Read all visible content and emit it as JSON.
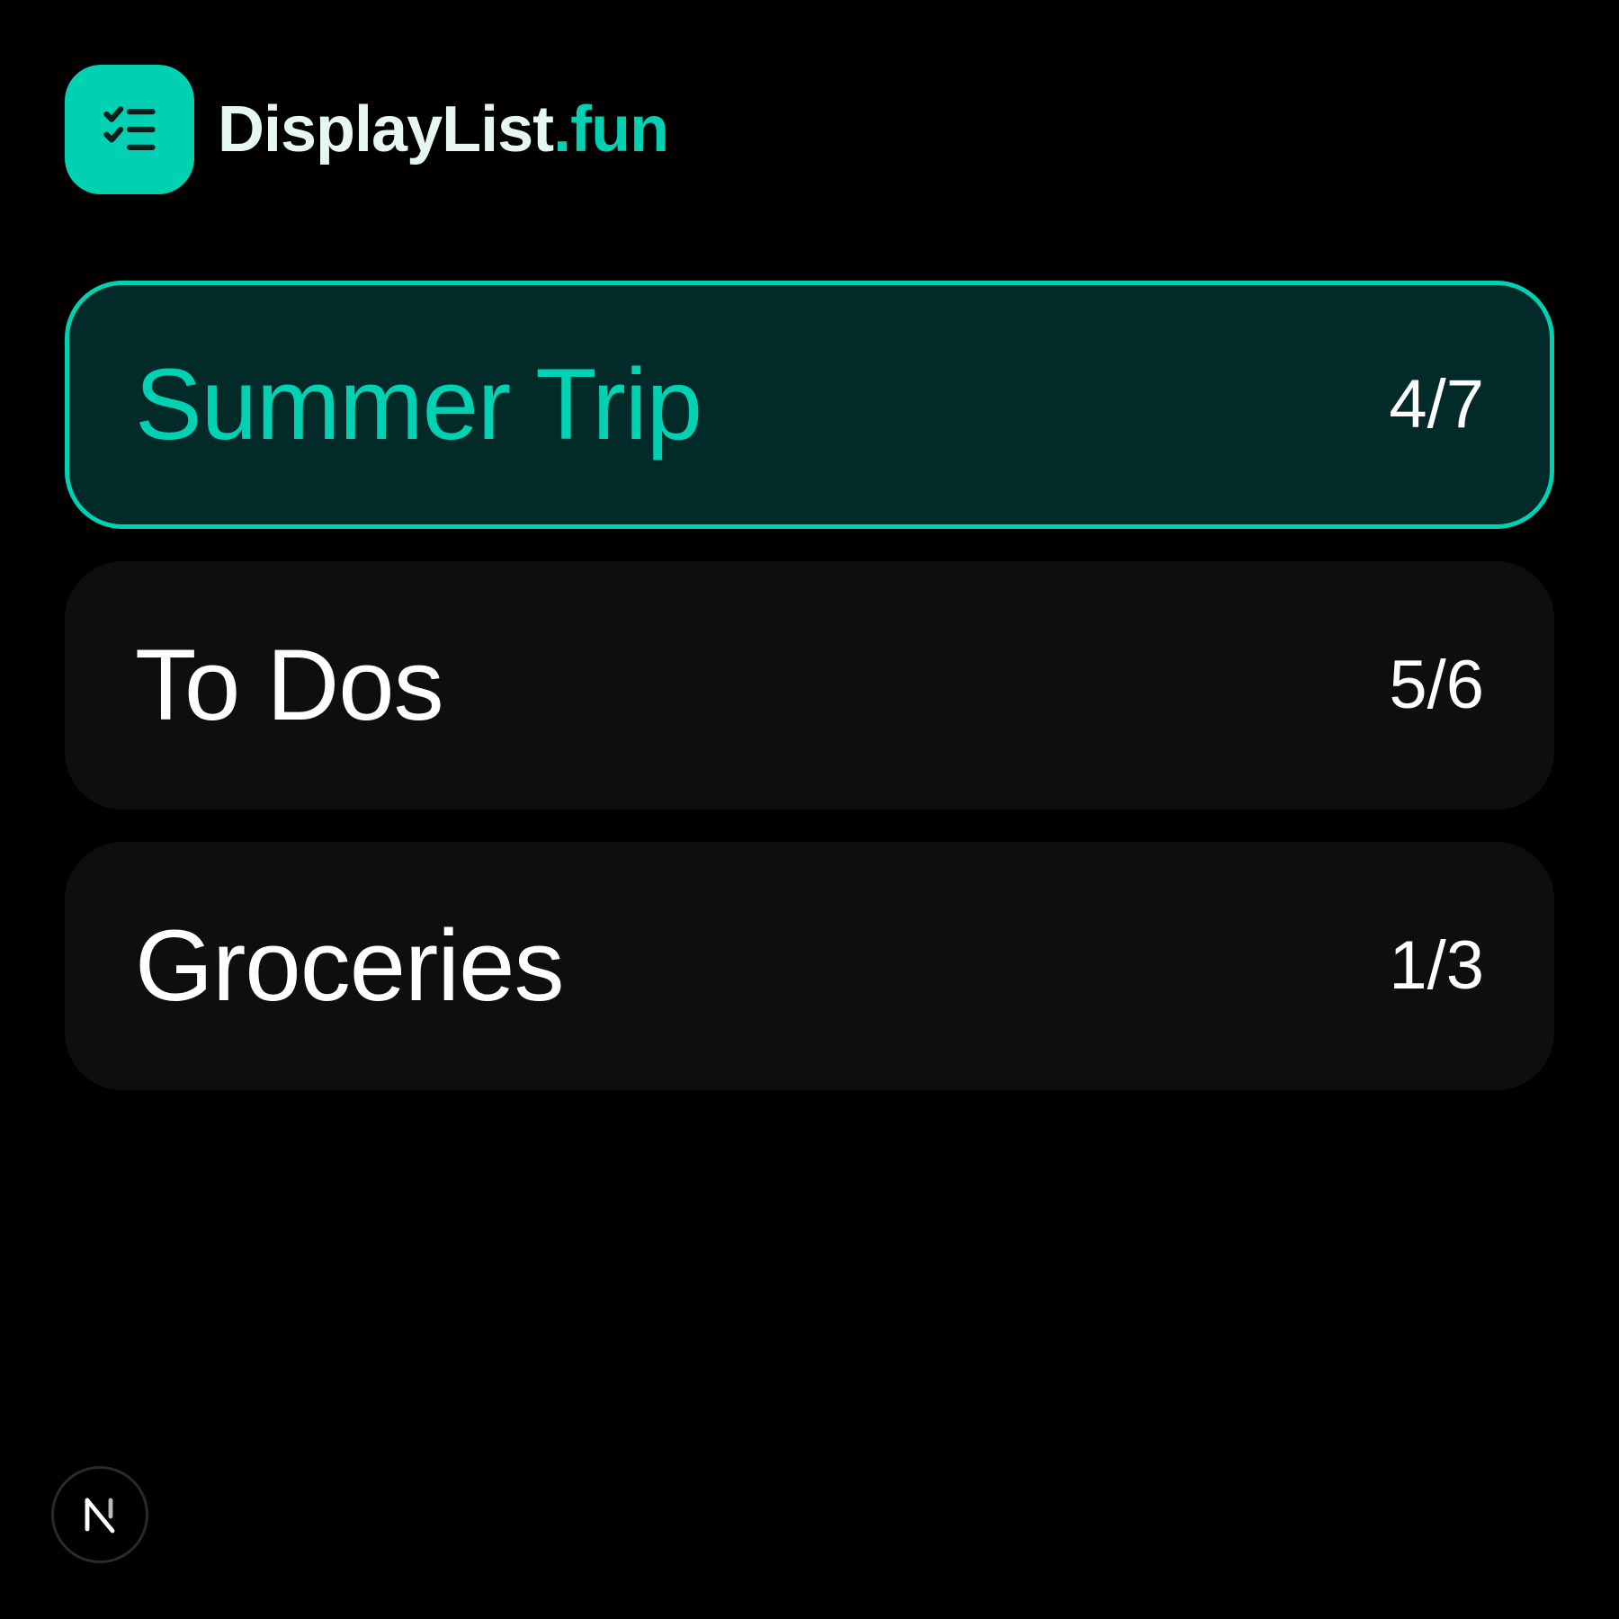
{
  "header": {
    "logo_icon": "checklist-icon",
    "brand_main": "DisplayList",
    "brand_accent": ".fun"
  },
  "lists": [
    {
      "name": "Summer Trip",
      "count": "4/7",
      "selected": true
    },
    {
      "name": "To Dos",
      "count": "5/6",
      "selected": false
    },
    {
      "name": "Groceries",
      "count": "1/3",
      "selected": false
    }
  ],
  "footer": {
    "badge_icon": "nextjs-n-icon"
  },
  "colors": {
    "accent": "#00d1b2",
    "selected_bg": "#012a28",
    "card_bg": "#0e0e0e",
    "page_bg": "#000000"
  }
}
